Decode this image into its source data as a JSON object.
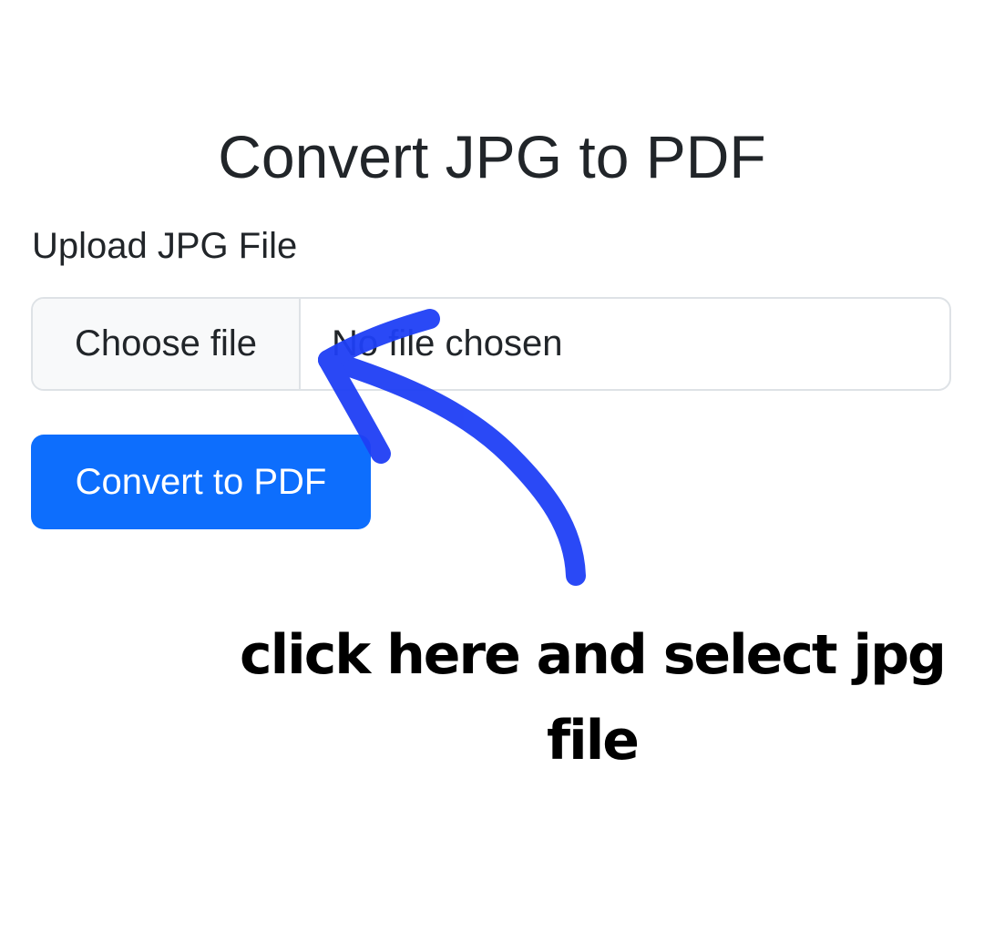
{
  "page": {
    "title": "Convert JPG to PDF"
  },
  "form": {
    "upload_label": "Upload JPG File",
    "file_input": {
      "button_label": "Choose file",
      "status_text": "No file chosen"
    },
    "convert_button_label": "Convert to PDF"
  },
  "annotation": {
    "text": "click here and select jpg file",
    "arrow_color": "#1f3ff5"
  },
  "colors": {
    "primary": "#0d6efd",
    "text": "#212529",
    "border": "#dee2e6",
    "file_button_bg": "#f8f9fa"
  }
}
